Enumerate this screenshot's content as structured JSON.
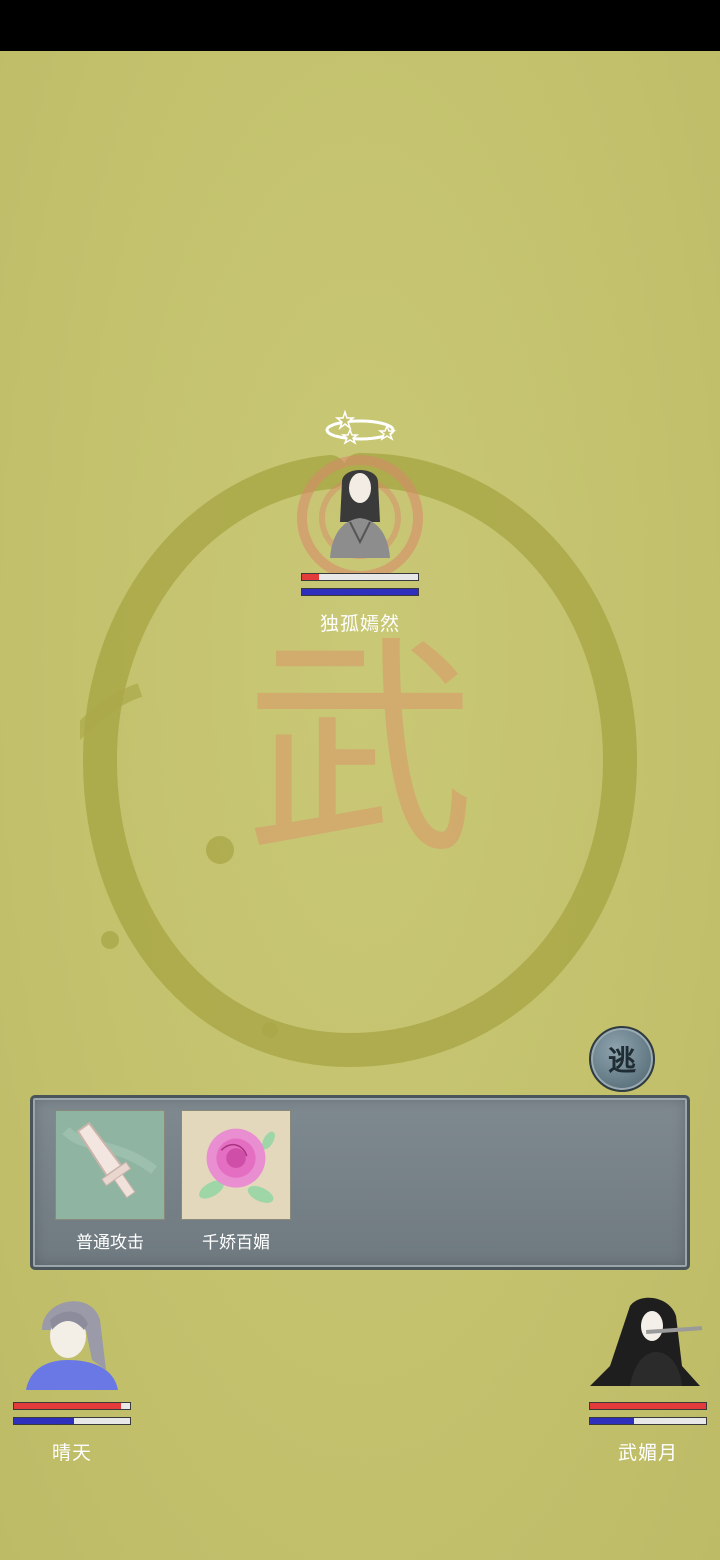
{
  "enemy": {
    "name": "独孤嫣然",
    "hp": 0.15,
    "mp": 1.0,
    "status": "stunned",
    "status_icon": "dizzy-stars-icon"
  },
  "skills": [
    {
      "label": "普通攻击",
      "icon": "sword-icon"
    },
    {
      "label": "千娇百媚",
      "icon": "rose-icon"
    }
  ],
  "flee_button": {
    "label": "逃"
  },
  "party": [
    {
      "name": "晴天",
      "hp": 0.92,
      "mp": 0.52
    },
    {
      "name": "武媚月",
      "hp": 1.0,
      "mp": 0.38
    }
  ],
  "background": {
    "emblem_char": "武"
  },
  "colors": {
    "hp": "#e33b3b",
    "mp": "#2f2fbd",
    "background": "#c5c36e"
  }
}
